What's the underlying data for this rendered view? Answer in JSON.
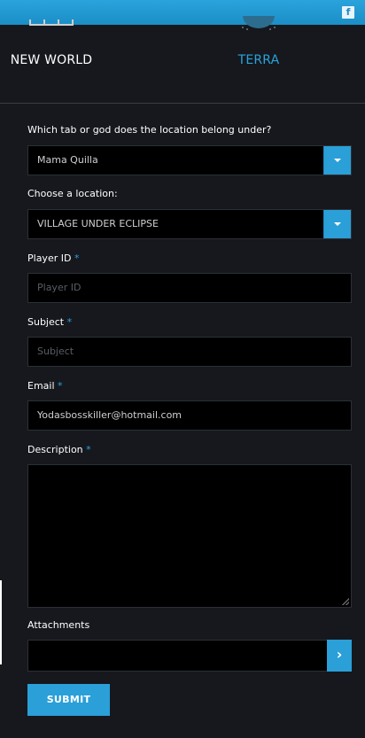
{
  "header": {
    "facebook_icon": "f"
  },
  "nav": {
    "items": [
      {
        "label": "NEW WORLD",
        "icon": "new-world-icon"
      },
      {
        "label": "TERRA",
        "icon": "terra-globe-icon",
        "active": true
      }
    ]
  },
  "form": {
    "tab_label": "Which tab or god does the location belong under?",
    "tab_value": "Mama Quilla",
    "location_label": "Choose a location:",
    "location_value": "VILLAGE UNDER ECLIPSE",
    "player_id_label": "Player ID",
    "player_id_placeholder": "Player ID",
    "subject_label": "Subject",
    "subject_placeholder": "Subject",
    "email_label": "Email",
    "email_value": "Yodasbosskiller@hotmail.com",
    "description_label": "Description",
    "attachments_label": "Attachments",
    "attach_button": "›",
    "submit_label": "SUBMIT",
    "required_mark": "*"
  },
  "colors": {
    "accent": "#2a9fd8",
    "background": "#16181d",
    "field_bg": "#000000"
  }
}
